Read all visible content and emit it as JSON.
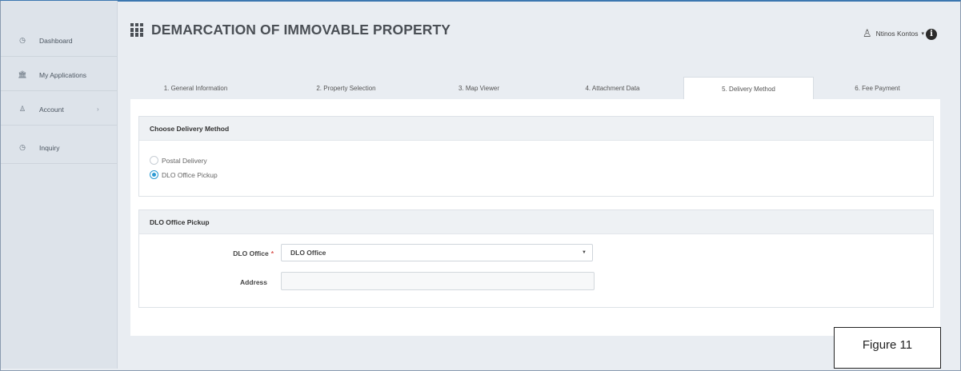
{
  "sidebar": {
    "items": [
      {
        "label": "Dashboard",
        "icon": "clock-icon",
        "glyph": "◷"
      },
      {
        "label": "My Applications",
        "icon": "bank-icon",
        "glyph": "🏛"
      },
      {
        "label": "Account",
        "icon": "user-icon",
        "glyph": "♙",
        "chevron": "›"
      },
      {
        "label": "Inquiry",
        "icon": "clock-icon",
        "glyph": "◷"
      }
    ]
  },
  "header": {
    "title": "DEMARCATION OF IMMOVABLE PROPERTY",
    "user_name": "Ntinos Kontos",
    "user_caret": "▾",
    "info_glyph": "i"
  },
  "tabs": [
    {
      "label": "1. General Information"
    },
    {
      "label": "2. Property Selection"
    },
    {
      "label": "3. Map Viewer"
    },
    {
      "label": "4. Attachment Data"
    },
    {
      "label": "5. Delivery Method",
      "active": true
    },
    {
      "label": "6. Fee Payment"
    }
  ],
  "delivery_panel": {
    "heading": "Choose Delivery Method",
    "options": [
      {
        "label": "Postal Delivery",
        "checked": false
      },
      {
        "label": "DLO Office Pickup",
        "checked": true
      }
    ]
  },
  "pickup_panel": {
    "heading": "DLO Office Pickup",
    "office_label": "DLO Office",
    "required_mark": "*",
    "office_value": "DLO Office",
    "select_arrow": "▼",
    "address_label": "Address",
    "address_value": ""
  },
  "figure_caption": "Figure 11",
  "colors": {
    "accent": "#2d9ad3",
    "required": "#d9534f",
    "sidebar_bg": "#dde3ea",
    "page_bg": "#e9edf2"
  }
}
